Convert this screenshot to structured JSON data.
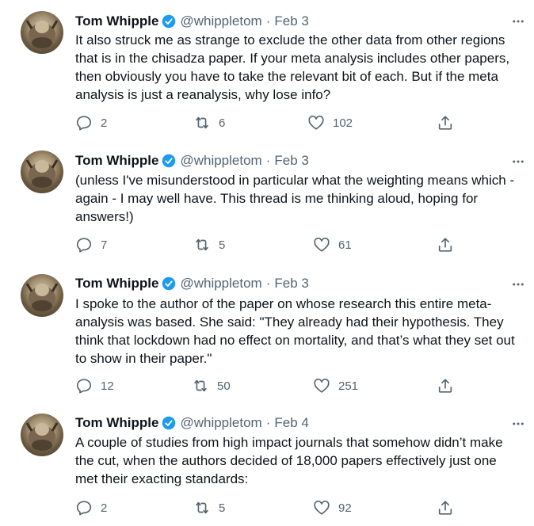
{
  "colors": {
    "text": "#0f1419",
    "muted": "#536471",
    "verified": "#1d9bf0"
  },
  "icons": {
    "verified": "verified-badge-icon",
    "more": "more-options-icon",
    "reply": "reply-icon",
    "retweet": "retweet-icon",
    "like": "heart-icon",
    "share": "share-icon"
  },
  "tweets": [
    {
      "name": "Tom Whipple",
      "handle": "@whippletom",
      "separator": "·",
      "date": "Feb 3",
      "lines": [
        "It also struck me as strange to exclude the other data from other regions",
        "that is in the chisadza paper. If your meta analysis includes other papers,",
        "then obviously you have to take the relevant bit of each. But if the meta",
        "analysis is just a reanalysis, why lose info?"
      ],
      "replies": "2",
      "retweets": "6",
      "likes": "102"
    },
    {
      "name": "Tom Whipple",
      "handle": "@whippletom",
      "separator": "·",
      "date": "Feb 3",
      "lines": [
        "(unless I've misunderstood in particular what the weighting means which -",
        "again - I may well have. This thread is me thinking aloud, hoping for",
        "answers!)"
      ],
      "replies": "7",
      "retweets": "5",
      "likes": "61"
    },
    {
      "name": "Tom Whipple",
      "handle": "@whippletom",
      "separator": "·",
      "date": "Feb 3",
      "lines": [
        "I spoke to the author of the paper on whose research this entire meta-",
        "analysis was based. She said: \"They already had their hypothesis. They",
        "think that lockdown had no effect on mortality, and that’s what they set out",
        "to show in their paper.\""
      ],
      "replies": "12",
      "retweets": "50",
      "likes": "251"
    },
    {
      "name": "Tom Whipple",
      "handle": "@whippletom",
      "separator": "·",
      "date": "Feb 4",
      "lines": [
        "A couple of studies from high impact journals that somehow didn’t make",
        "the cut, when the authors decided of 18,000 papers effectively just one",
        "met their exacting standards:"
      ],
      "replies": "2",
      "retweets": "5",
      "likes": "92"
    }
  ]
}
